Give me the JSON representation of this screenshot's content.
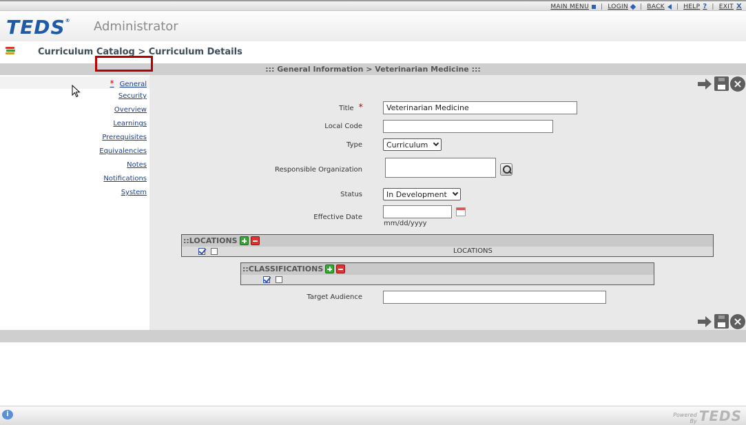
{
  "topnav": {
    "main_menu": "MAIN MENU",
    "login": "LOGIN",
    "back": "BACK",
    "help": "HELP",
    "exit": "EXIT",
    "help_glyph": "?",
    "exit_glyph": "X"
  },
  "header": {
    "logo": "TEDS",
    "logo_mark": "®",
    "app_name": "Administrator"
  },
  "breadcrumb": "Curriculum Catalog > Curriculum Details",
  "section_title": "::: General Information > Veterinarian Medicine :::",
  "sidenav": {
    "items": [
      {
        "label": "General",
        "required_mark": "*"
      },
      {
        "label": "Security"
      },
      {
        "label": "Overview"
      },
      {
        "label": "Learnings"
      },
      {
        "label": "Prerequisites",
        "highlighted": true
      },
      {
        "label": "Equivalencies"
      },
      {
        "label": "Notes"
      },
      {
        "label": "Notifications"
      },
      {
        "label": "System"
      }
    ]
  },
  "form": {
    "title_label": "Title",
    "title_required": "*",
    "title_value": "Veterinarian Medicine",
    "local_code_label": "Local Code",
    "local_code_value": "",
    "type_label": "Type",
    "type_value": "Curriculum",
    "resp_org_label": "Responsible Organization",
    "resp_org_value": "",
    "status_label": "Status",
    "status_value": "In Development",
    "effective_date_label": "Effective Date",
    "effective_date_value": "",
    "date_hint": "mm/dd/yyyy",
    "target_audience_label": "Target Audience",
    "target_audience_value": ""
  },
  "locations": {
    "title": "::LOCATIONS",
    "column": "LOCATIONS"
  },
  "classifications": {
    "title": "::CLASSIFICATIONS"
  },
  "footer": {
    "info_glyph": "i",
    "powered_line1": "Powered",
    "powered_line2": "By",
    "powered_logo": "TEDS"
  },
  "colors": {
    "brand_blue": "#1f5aa8",
    "link": "#1a3f8a",
    "required": "#cc0000",
    "highlight_box": "#b40000"
  },
  "icons": {
    "save": "disk-icon",
    "next": "arrow-right-icon",
    "close": "close-circle-icon",
    "search": "magnifier-icon",
    "calendar": "calendar-icon",
    "add": "plus-icon",
    "remove": "minus-icon"
  }
}
